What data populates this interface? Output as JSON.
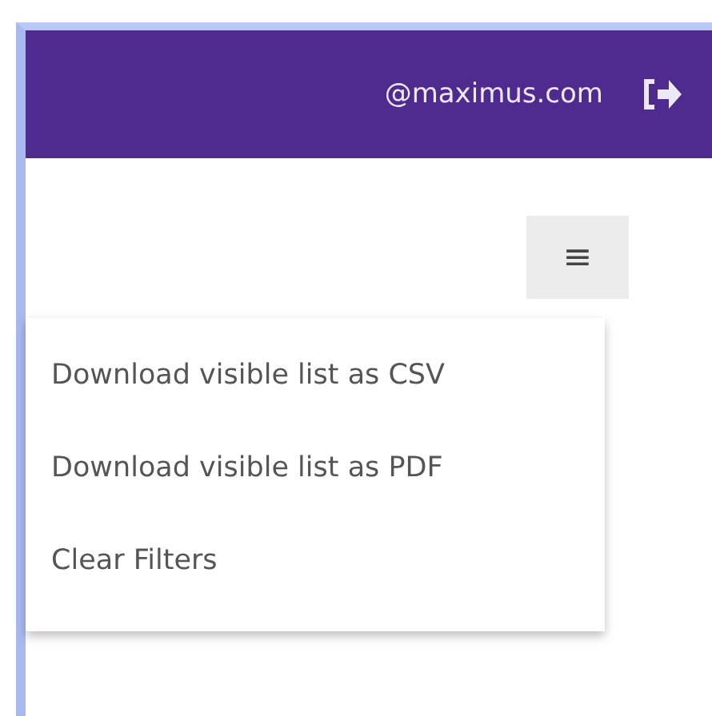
{
  "header": {
    "user_email": "@maximus.com"
  },
  "menu_button": {
    "label": "≡",
    "expanded": true
  },
  "menu": {
    "items": [
      {
        "label": "Download visible list as CSV"
      },
      {
        "label": "Download visible list as PDF"
      },
      {
        "label": "Clear Filters"
      }
    ]
  }
}
